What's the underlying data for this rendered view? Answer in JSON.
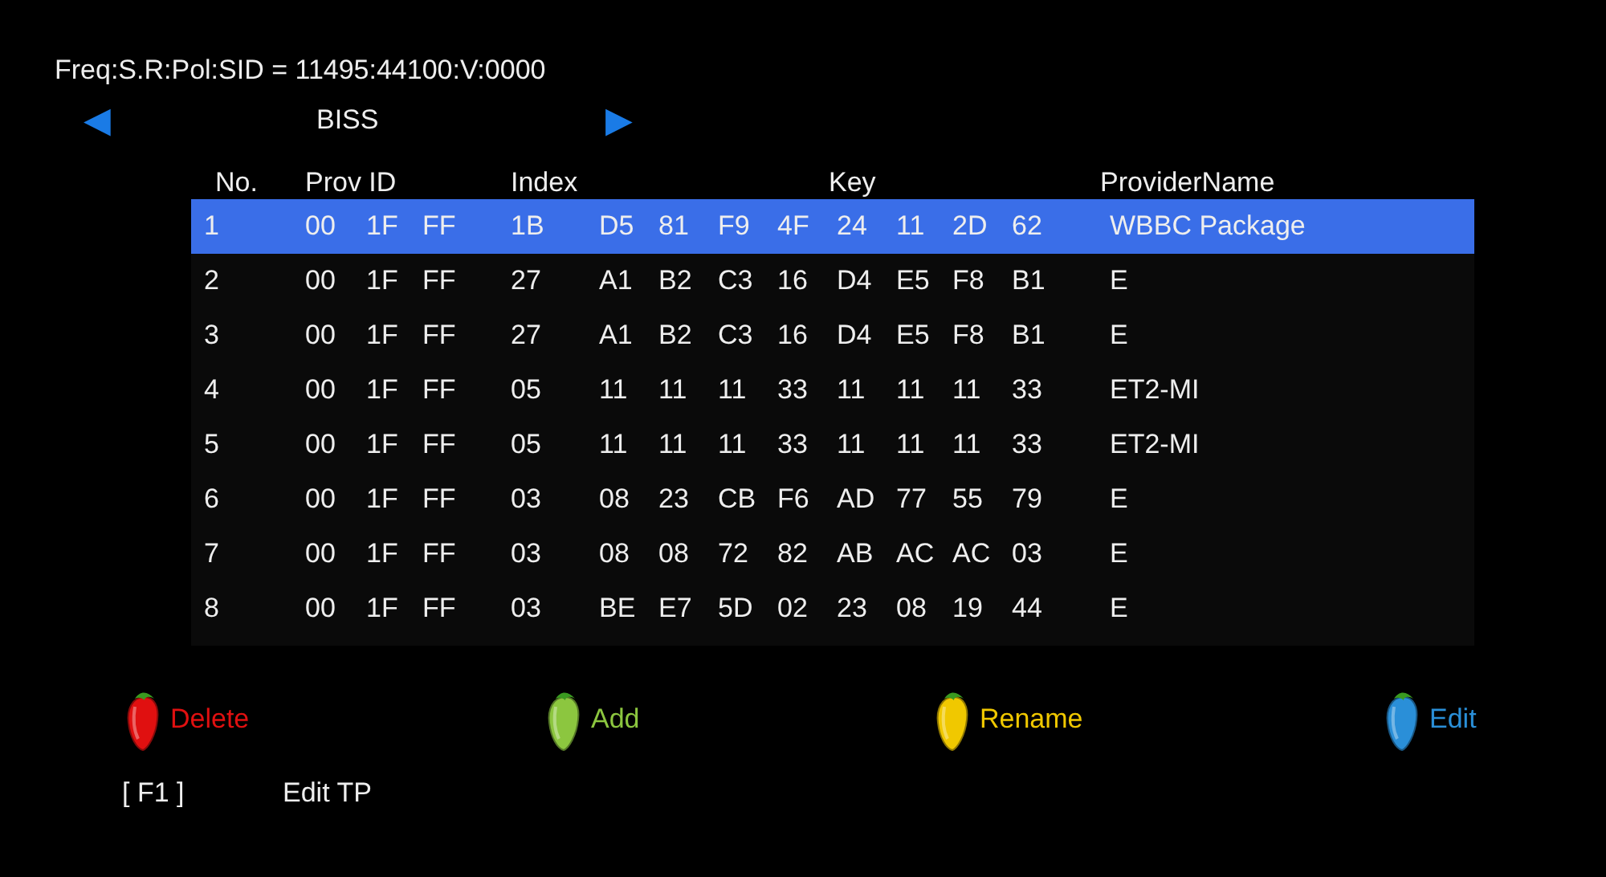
{
  "transponder": "Freq:S.R:Pol:SID = 11495:44100:V:0000",
  "selector": {
    "prev": "◀",
    "label": "BISS",
    "next": "▶"
  },
  "table": {
    "columns": [
      "No.",
      "Prov ID",
      "Index",
      "Key",
      "ProviderName"
    ],
    "rows": [
      {
        "no": "1",
        "prov_id": [
          "00",
          "1F",
          "FF"
        ],
        "index": "1B",
        "key": [
          "D5",
          "81",
          "F9",
          "4F",
          "24",
          "11",
          "2D",
          "62"
        ],
        "name": "WBBC Package",
        "selected": true
      },
      {
        "no": "2",
        "prov_id": [
          "00",
          "1F",
          "FF"
        ],
        "index": "27",
        "key": [
          "A1",
          "B2",
          "C3",
          "16",
          "D4",
          "E5",
          "F8",
          "B1"
        ],
        "name": "E",
        "selected": false
      },
      {
        "no": "3",
        "prov_id": [
          "00",
          "1F",
          "FF"
        ],
        "index": "27",
        "key": [
          "A1",
          "B2",
          "C3",
          "16",
          "D4",
          "E5",
          "F8",
          "B1"
        ],
        "name": "E",
        "selected": false
      },
      {
        "no": "4",
        "prov_id": [
          "00",
          "1F",
          "FF"
        ],
        "index": "05",
        "key": [
          "11",
          "11",
          "11",
          "33",
          "11",
          "11",
          "11",
          "33"
        ],
        "name": "ET2-MI",
        "selected": false
      },
      {
        "no": "5",
        "prov_id": [
          "00",
          "1F",
          "FF"
        ],
        "index": "05",
        "key": [
          "11",
          "11",
          "11",
          "33",
          "11",
          "11",
          "11",
          "33"
        ],
        "name": "ET2-MI",
        "selected": false
      },
      {
        "no": "6",
        "prov_id": [
          "00",
          "1F",
          "FF"
        ],
        "index": "03",
        "key": [
          "08",
          "23",
          "CB",
          "F6",
          "AD",
          "77",
          "55",
          "79"
        ],
        "name": "E",
        "selected": false
      },
      {
        "no": "7",
        "prov_id": [
          "00",
          "1F",
          "FF"
        ],
        "index": "03",
        "key": [
          "08",
          "08",
          "72",
          "82",
          "AB",
          "AC",
          "AC",
          "03"
        ],
        "name": "E",
        "selected": false
      },
      {
        "no": "8",
        "prov_id": [
          "00",
          "1F",
          "FF"
        ],
        "index": "03",
        "key": [
          "BE",
          "E7",
          "5D",
          "02",
          "23",
          "08",
          "19",
          "44"
        ],
        "name": "E",
        "selected": false
      }
    ]
  },
  "color_keys": [
    {
      "label": "Delete",
      "color": "#e01010"
    },
    {
      "label": "Add",
      "color": "#8cc63f"
    },
    {
      "label": "Rename",
      "color": "#f0c800"
    },
    {
      "label": "Edit",
      "color": "#2a8fd8"
    }
  ],
  "hotkey": {
    "key": "[ F1 ]",
    "action": "Edit TP"
  }
}
